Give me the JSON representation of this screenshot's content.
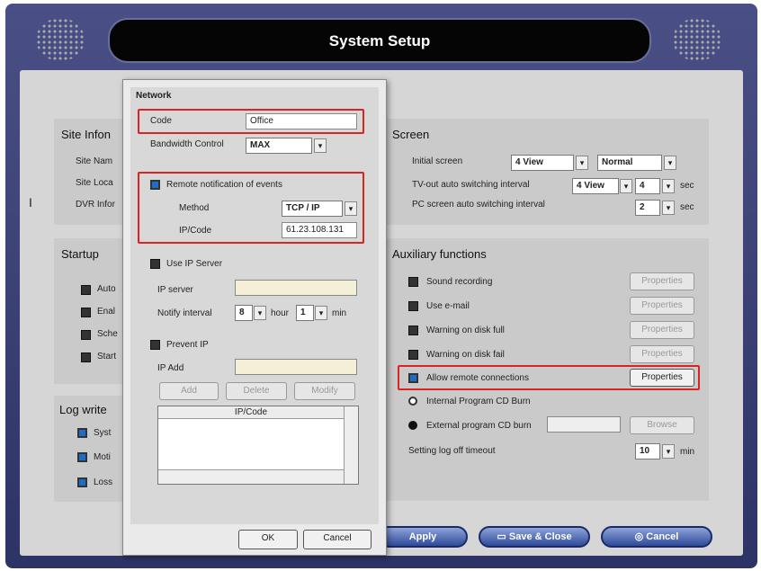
{
  "title": "System Setup",
  "left": {
    "site": {
      "title": "Site Infon",
      "items": [
        "Site Nam",
        "Site Loca",
        "DVR Infor"
      ]
    },
    "startup": {
      "title": "Startup",
      "items": [
        "Auto",
        "Enal",
        "Sche",
        "Start"
      ]
    },
    "log": {
      "title": "Log write",
      "items": [
        "Syst",
        "Moti",
        "Loss"
      ]
    }
  },
  "screen": {
    "title": "Screen",
    "initial_label": "Initial screen",
    "initial_value": "4 View",
    "initial_mode": "Normal",
    "tvout_label": "TV-out auto switching interval",
    "tvout_view": "4 View",
    "tvout_value": "4",
    "sec1": "sec",
    "pc_label": "PC screen auto switching interval",
    "pc_value": "2",
    "sec2": "sec"
  },
  "aux": {
    "title": "Auxiliary functions",
    "items": [
      {
        "label": "Sound recording",
        "btn": "Properties"
      },
      {
        "label": "Use e-mail",
        "btn": "Properties"
      },
      {
        "label": "Warning on disk full",
        "btn": "Properties"
      },
      {
        "label": "Warning on disk fail",
        "btn": "Properties"
      },
      {
        "label": "Allow remote connections",
        "btn": "Properties"
      }
    ],
    "internal": "Internal Program CD Burn",
    "external": "External program CD burn",
    "browse": "Browse",
    "logoff_label": "Setting log off timeout",
    "logoff_value": "10",
    "min": "min"
  },
  "buttons": {
    "apply": "Apply",
    "save": "Save & Close",
    "cancel": "Cancel"
  },
  "dialog": {
    "title": "Network",
    "code_label": "Code",
    "code_value": "Office",
    "bw_label": "Bandwidth Control",
    "bw_value": "MAX",
    "remote_label": "Remote notification of events",
    "method_label": "Method",
    "method_value": "TCP / IP",
    "ip_label": "IP/Code",
    "ip_value": "61.23.108.131",
    "useip_label": "Use IP Server",
    "ipserver_label": "IP server",
    "notify_label": "Notify interval",
    "notify_hour": "8",
    "hour": "hour",
    "notify_min": "1",
    "min": "min",
    "prevent_label": "Prevent IP",
    "ipadd_label": "IP Add",
    "add": "Add",
    "delete": "Delete",
    "modify": "Modify",
    "col": "IP/Code",
    "ok": "OK",
    "cancel": "Cancel"
  },
  "side_glyph": "I"
}
